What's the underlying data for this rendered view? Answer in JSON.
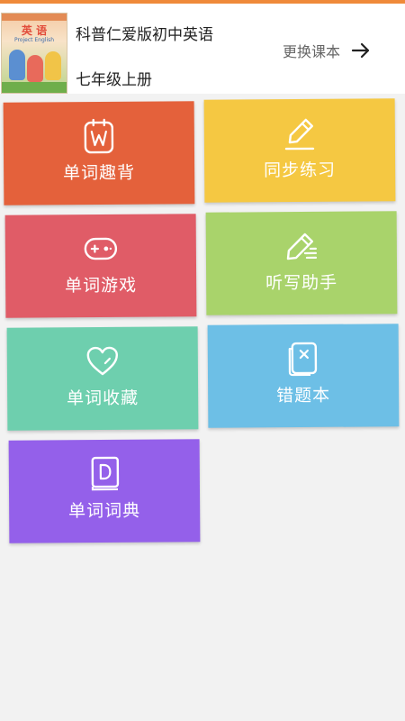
{
  "header": {
    "book_title": "科普仁爱版初中英语",
    "grade": "七年级上册",
    "change_book_label": "更换课本",
    "cover": {
      "title": "英 语",
      "subtitle": "Project English"
    }
  },
  "tiles": [
    {
      "label": "单词趣背",
      "icon": "word-card-icon",
      "color": "#e4613b"
    },
    {
      "label": "同步练习",
      "icon": "pencil-icon",
      "color": "#f5c842"
    },
    {
      "label": "单词游戏",
      "icon": "gamepad-icon",
      "color": "#e05c67"
    },
    {
      "label": "听写助手",
      "icon": "dictation-pen-icon",
      "color": "#a9d36b"
    },
    {
      "label": "单词收藏",
      "icon": "heart-icon",
      "color": "#6ecfae"
    },
    {
      "label": "错题本",
      "icon": "mistake-book-icon",
      "color": "#6dbfe6"
    },
    {
      "label": "单词词典",
      "icon": "dictionary-icon",
      "color": "#9460ea"
    }
  ],
  "colors": {
    "accent": "#ef8a3a",
    "background": "#f2f2f2"
  }
}
